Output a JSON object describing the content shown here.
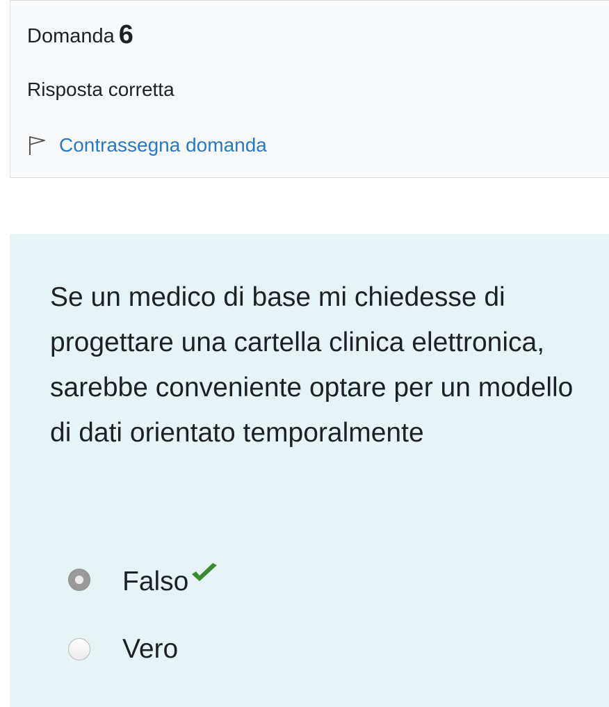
{
  "question_info": {
    "label": "Domanda",
    "number": "6",
    "state": "Risposta corretta",
    "flag_label": "Contrassegna domanda",
    "link_color": "#2b78c2"
  },
  "formulation": {
    "text": "Se un medico di base mi chiedesse di progettare una cartella clinica elettronica, sarebbe conveniente optare per un modello di dati orientato temporalmente",
    "background": "#e7f3f5",
    "options": [
      {
        "label": "Falso",
        "selected": true,
        "correct": true,
        "icon": "check-icon"
      },
      {
        "label": "Vero",
        "selected": false,
        "correct": false
      }
    ],
    "correct_color": "#3a8a2f"
  }
}
